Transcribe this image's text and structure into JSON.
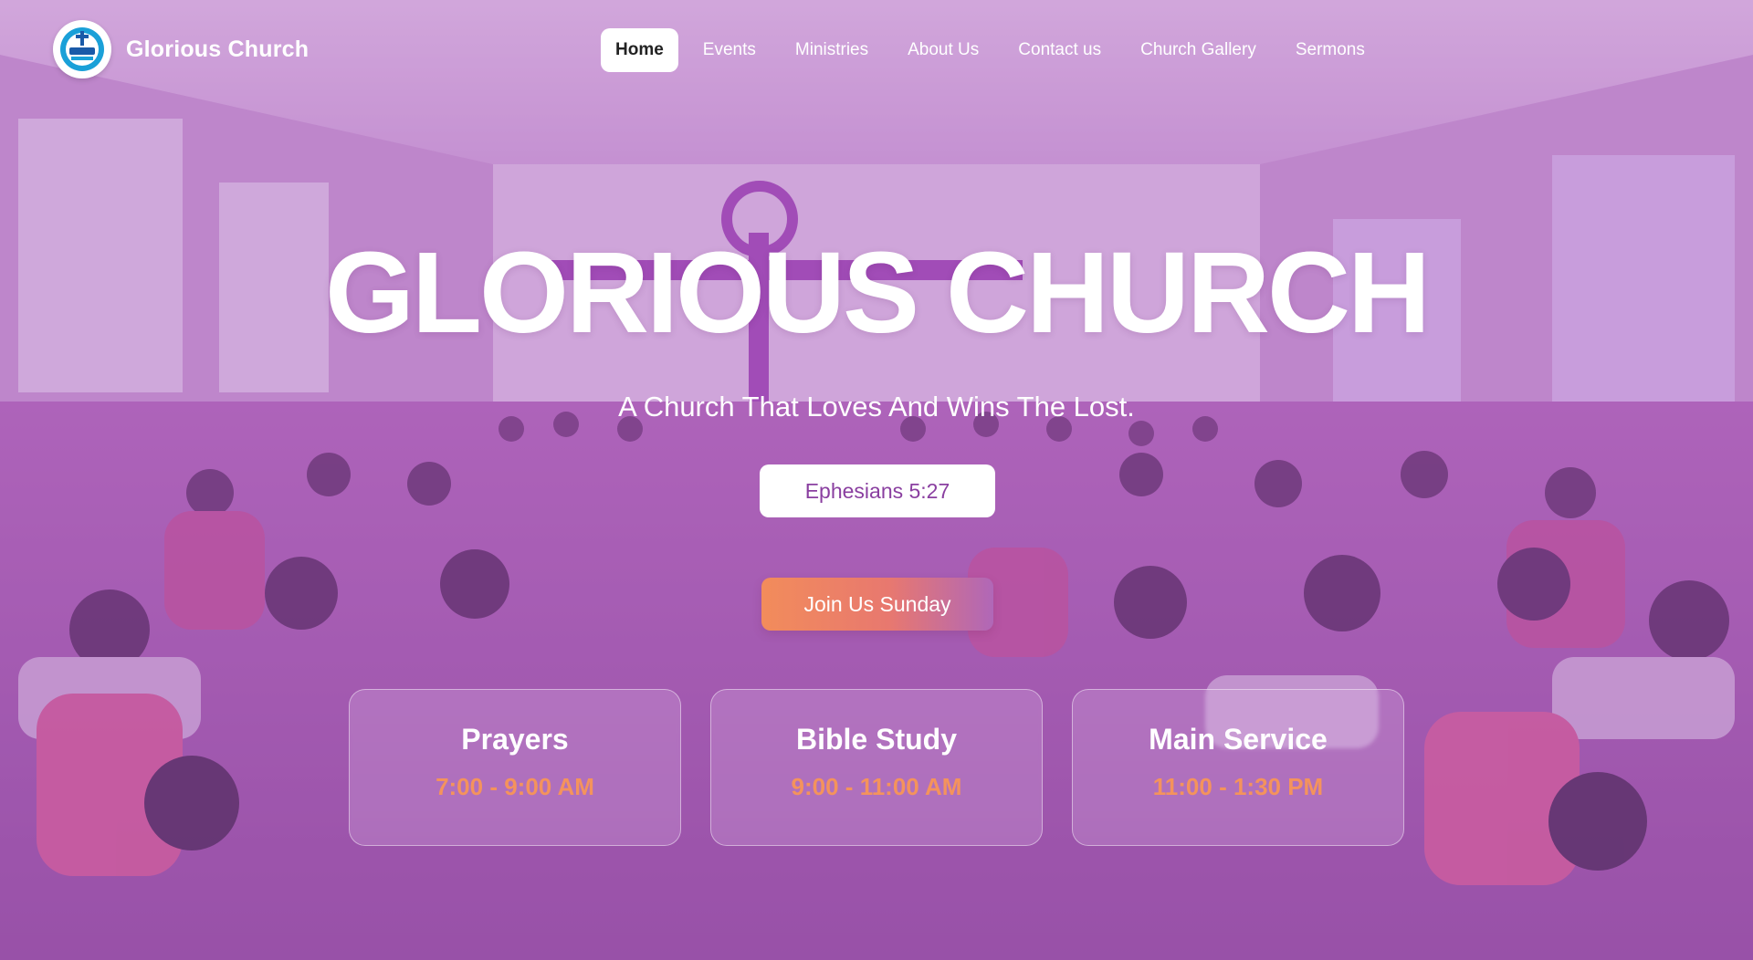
{
  "brand": {
    "name": "Glorious Church",
    "logo_icon": "church-logo-icon"
  },
  "nav": {
    "items": [
      {
        "label": "Home",
        "active": true
      },
      {
        "label": "Events",
        "active": false
      },
      {
        "label": "Ministries",
        "active": false
      },
      {
        "label": "About Us",
        "active": false
      },
      {
        "label": "Contact us",
        "active": false
      },
      {
        "label": "Church Gallery",
        "active": false
      },
      {
        "label": "Sermons",
        "active": false
      }
    ]
  },
  "hero": {
    "title": "GLORIOUS CHURCH",
    "subtitle": "A Church That Loves And Wins The Lost.",
    "verse": "Ephesians 5:27",
    "cta_label": "Join Us Sunday"
  },
  "services": [
    {
      "name": "Prayers",
      "time": "7:00 - 9:00 AM"
    },
    {
      "name": "Bible Study",
      "time": "9:00 - 11:00 AM"
    },
    {
      "name": "Main Service",
      "time": "11:00 - 1:30 PM"
    }
  ],
  "colors": {
    "accent_purple": "#8a3fa0",
    "accent_orange": "#f4935c",
    "overlay": "#aa5abe"
  }
}
